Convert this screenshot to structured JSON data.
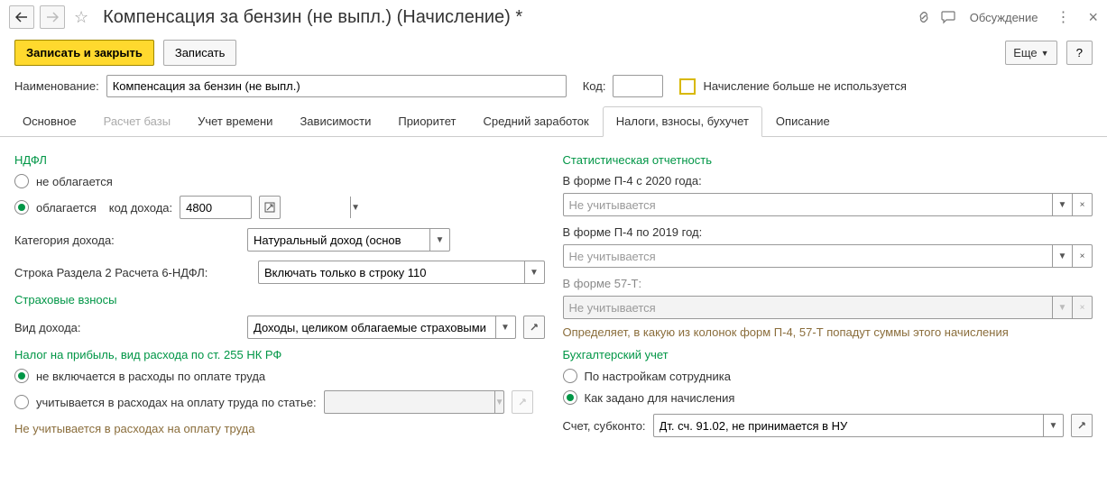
{
  "header": {
    "title": "Компенсация за бензин (не выпл.) (Начисление) *",
    "discussion": "Обсуждение"
  },
  "actions": {
    "save_close": "Записать и закрыть",
    "save": "Записать",
    "more": "Еще"
  },
  "form": {
    "name_label": "Наименование:",
    "name_value": "Компенсация за бензин (не выпл.)",
    "code_label": "Код:",
    "code_value": "",
    "not_used_label": "Начисление больше не используется"
  },
  "tabs": [
    "Основное",
    "Расчет базы",
    "Учет времени",
    "Зависимости",
    "Приоритет",
    "Средний заработок",
    "Налоги, взносы, бухучет",
    "Описание"
  ],
  "ndfl": {
    "header": "НДФЛ",
    "opt1": "не облагается",
    "opt2": "облагается",
    "income_code_label": "код дохода:",
    "income_code_value": "4800",
    "category_label": "Категория дохода:",
    "category_value": "Натуральный доход (основ",
    "section2_label": "Строка Раздела 2 Расчета 6-НДФЛ:",
    "section2_value": "Включать только в строку 110"
  },
  "insurance": {
    "header": "Страховые взносы",
    "type_label": "Вид дохода:",
    "type_value": "Доходы, целиком облагаемые страховыми взнос"
  },
  "profit_tax": {
    "header": "Налог на прибыль, вид расхода по ст. 255 НК РФ",
    "opt1": "не включается в расходы по оплате труда",
    "opt2": "учитывается в расходах на оплату труда по статье:",
    "note": "Не учитывается в расходах на оплату труда"
  },
  "stats": {
    "header": "Статистическая отчетность",
    "p4_2020_label": "В форме П-4 с 2020 года:",
    "p4_2019_label": "В форме П-4 по 2019 год:",
    "t57_label": "В форме 57-Т:",
    "placeholder": "Не учитывается",
    "hint": "Определяет, в какую из колонок форм П-4, 57-Т попадут суммы этого начисления"
  },
  "accounting": {
    "header": "Бухгалтерский учет",
    "opt1": "По настройкам сотрудника",
    "opt2": "Как задано для начисления",
    "account_label": "Счет, субконто:",
    "account_value": "Дт. сч. 91.02, не принимается в НУ"
  }
}
